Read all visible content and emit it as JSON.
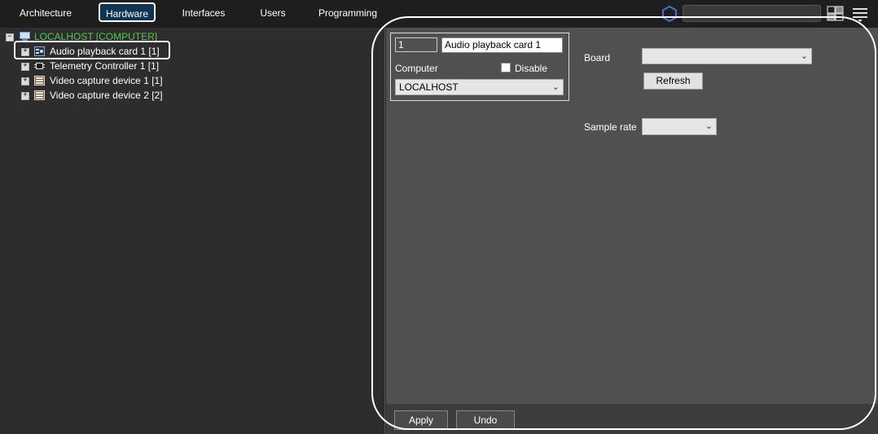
{
  "tabs": [
    {
      "label": "Architecture",
      "active": false
    },
    {
      "label": "Hardware",
      "active": true
    },
    {
      "label": "Interfaces",
      "active": false
    },
    {
      "label": "Users",
      "active": false
    },
    {
      "label": "Programming",
      "active": false
    }
  ],
  "search": {
    "value": ""
  },
  "tree": {
    "root": {
      "label": "LOCALHOST [COMPUTER]",
      "expander": "−"
    },
    "items": [
      {
        "label": "Audio playback card 1 [1]",
        "icon": "audio-card-icon",
        "expander": "+"
      },
      {
        "label": "Telemetry Controller 1 [1]",
        "icon": "telemetry-chip-icon",
        "expander": "+"
      },
      {
        "label": "Video capture device 1 [1]",
        "icon": "video-board-icon",
        "expander": "+"
      },
      {
        "label": "Video capture device 2 [2]",
        "icon": "video-board-icon",
        "expander": "+"
      }
    ]
  },
  "form": {
    "id_value": "1",
    "name_value": "Audio playback card 1",
    "computer_label": "Computer",
    "disable_label": "Disable",
    "computer_value": "LOCALHOST",
    "board_label": "Board",
    "board_value": "",
    "refresh_label": "Refresh",
    "sample_rate_label": "Sample rate",
    "sample_rate_value": ""
  },
  "footer": {
    "apply_label": "Apply",
    "undo_label": "Undo"
  },
  "colors": {
    "root_green": "#4ec94e",
    "active_tab": "#0e3553",
    "panel": "#505050"
  }
}
